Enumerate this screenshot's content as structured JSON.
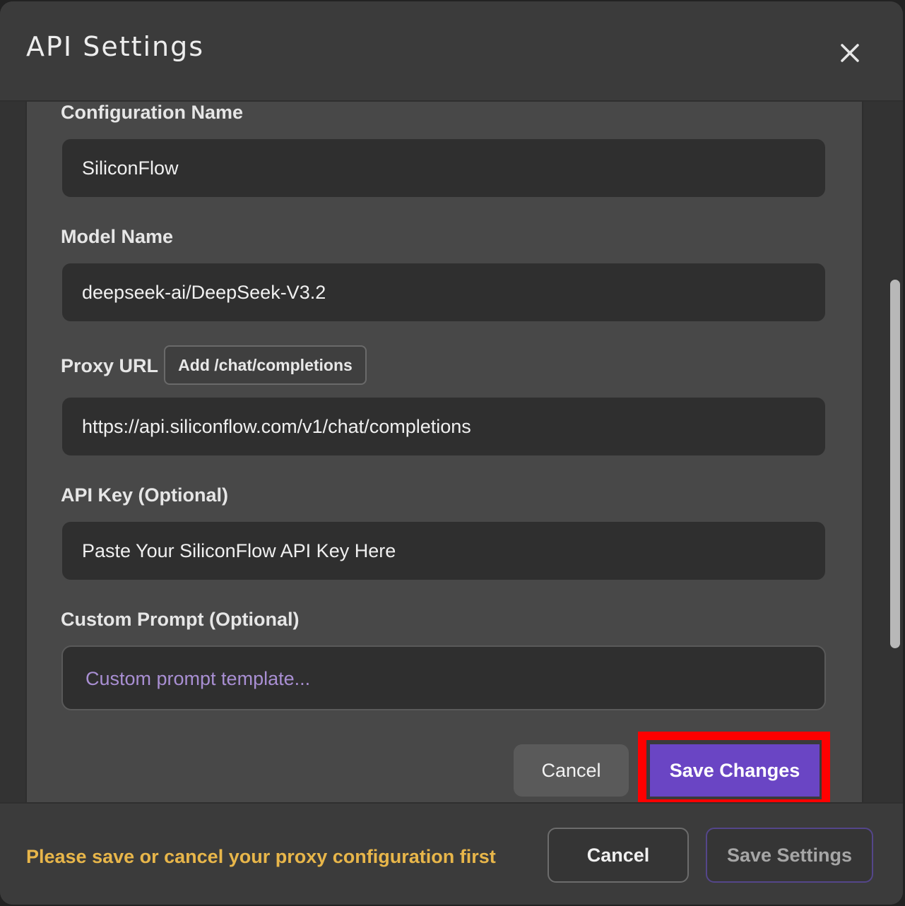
{
  "dialog": {
    "title": "API Settings",
    "close_icon": "close-icon"
  },
  "form": {
    "config_name": {
      "label": "Configuration Name",
      "value": "SiliconFlow"
    },
    "model_name": {
      "label": "Model Name",
      "value": "deepseek-ai/DeepSeek-V3.2"
    },
    "proxy_url": {
      "label": "Proxy URL",
      "add_button_label": "Add /chat/completions",
      "value": "https://api.siliconflow.com/v1/chat/completions"
    },
    "api_key": {
      "label": "API Key (Optional)",
      "placeholder": "Paste Your SiliconFlow API Key Here"
    },
    "custom_prompt": {
      "label": "Custom Prompt (Optional)",
      "placeholder": "Custom prompt template..."
    },
    "cancel_label": "Cancel",
    "save_changes_label": "Save Changes"
  },
  "footer": {
    "warning": "Please save or cancel your proxy configuration first",
    "cancel_label": "Cancel",
    "save_settings_label": "Save Settings"
  },
  "colors": {
    "accent": "#6a45c4",
    "warning": "#e8b64a",
    "highlight": "#ff0000",
    "placeholder": "#a98fd3"
  }
}
